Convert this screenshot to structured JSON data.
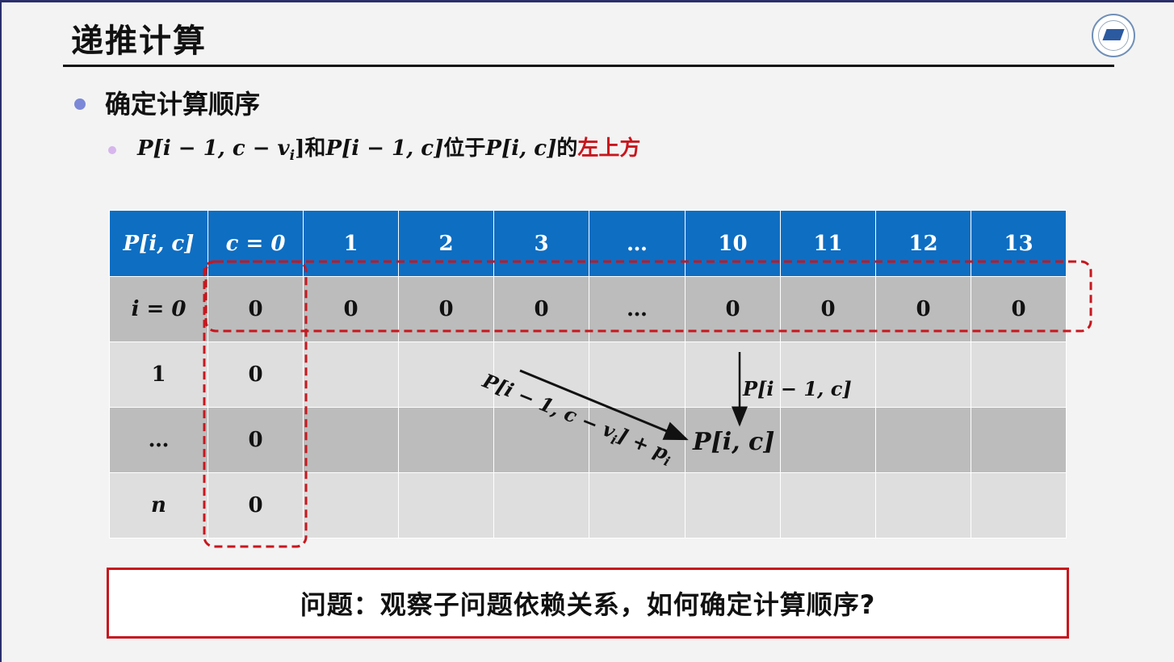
{
  "slide": {
    "title": "递推计算"
  },
  "bullets": {
    "level1": "确定计算顺序",
    "level2": {
      "a_prefix": "P[i − 1, c − v",
      "a_sub": "i",
      "a_suffix": "]",
      "conj": "和",
      "b": "P[i − 1, c]",
      "mid": "位于",
      "c": "P[i, c]",
      "de": "的",
      "highlight": "左上方"
    }
  },
  "table": {
    "header": [
      "P[i, c]",
      "c = 0",
      "1",
      "2",
      "3",
      "…",
      "10",
      "11",
      "12",
      "13"
    ],
    "rows": [
      [
        "i = 0",
        "0",
        "0",
        "0",
        "0",
        "…",
        "0",
        "0",
        "0",
        "0"
      ],
      [
        "1",
        "0",
        "",
        "",
        "",
        "",
        "",
        "",
        "",
        ""
      ],
      [
        "…",
        "0",
        "",
        "",
        "",
        "",
        "",
        "",
        "",
        ""
      ],
      [
        "n",
        "0",
        "",
        "",
        "",
        "",
        "",
        "",
        "",
        ""
      ]
    ]
  },
  "annotations": {
    "diag_label": "P[i − 1, c − v",
    "diag_sub": "i",
    "diag_tail": "] + p",
    "diag_tail_sub": "i",
    "down_label": "P[i − 1, c]",
    "target_label": "P[i, c]"
  },
  "question": "问题：观察子问题依赖关系，如何确定计算顺序?",
  "colors": {
    "header_blue": "#0e6ec2",
    "highlight_red": "#c8161d",
    "row_dark": "#bcbcbc",
    "row_light": "#dedede"
  }
}
